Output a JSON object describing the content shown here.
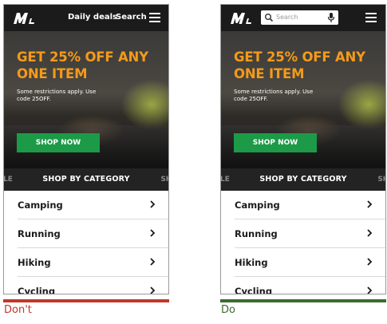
{
  "colors": {
    "header_bg": "#1b1b1b",
    "promo_orange": "#f59a1a",
    "shop_green": "#1d9a48",
    "category_bar_bg": "#232323",
    "dont_red": "#c0392b",
    "do_green": "#3d6b30"
  },
  "dont": {
    "header": {
      "logo_icon": "brand-logo-icon",
      "daily_deals": "Daily deals",
      "search": "Search",
      "menu_icon": "hamburger-menu-icon"
    },
    "hero": {
      "headline_line1": "GET 25% OFF ANY",
      "headline_line2": "ONE ITEM",
      "restrictions_line1": "Some restrictions apply. Use",
      "restrictions_line2": "code 25OFF.",
      "cta": "SHOP NOW"
    },
    "category_bar": {
      "left": "ALE",
      "title": "SHOP BY CATEGORY",
      "right": "SHO"
    },
    "categories": [
      "Camping",
      "Running",
      "Hiking",
      "Cycling"
    ],
    "caption": "Don't"
  },
  "do": {
    "header": {
      "logo_icon": "brand-logo-icon",
      "search_placeholder": "Search",
      "search_icon": "magnifier-icon",
      "mic_icon": "microphone-icon",
      "menu_icon": "hamburger-menu-icon"
    },
    "hero": {
      "headline_line1": "GET 25% OFF ANY",
      "headline_line2": "ONE ITEM",
      "restrictions_line1": "Some restrictions apply. Use",
      "restrictions_line2": "code 25OFF.",
      "cta": "SHOP NOW"
    },
    "category_bar": {
      "left": "ALE",
      "title": "SHOP BY CATEGORY",
      "right": "SHO"
    },
    "categories": [
      "Camping",
      "Running",
      "Hiking",
      "Cycling"
    ],
    "caption": "Do"
  }
}
